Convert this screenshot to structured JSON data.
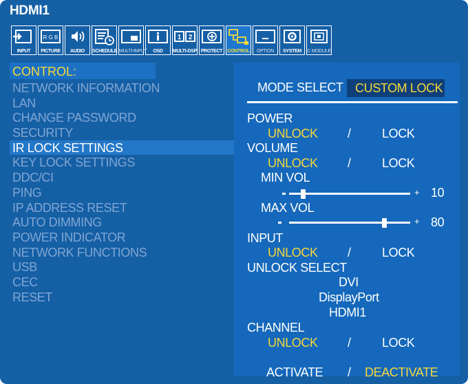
{
  "window": {
    "title": "HDMI1"
  },
  "toolbar": [
    {
      "label": "INPUT",
      "icon": "input-icon"
    },
    {
      "label": "PICTURE",
      "icon": "picture-rgb-icon"
    },
    {
      "label": "AUDIO",
      "icon": "speaker-icon"
    },
    {
      "label": "SCHEDULE",
      "icon": "schedule-icon"
    },
    {
      "label": "MULTI-INPUT",
      "icon": "multi-input-icon"
    },
    {
      "label": "OSD",
      "icon": "info-icon"
    },
    {
      "label": "MULTI-DSP",
      "icon": "multi-display-icon"
    },
    {
      "label": "PROTECT",
      "icon": "protect-plus-icon"
    },
    {
      "label": "CONTROL",
      "icon": "control-icon"
    },
    {
      "label": "OPTION",
      "icon": "option-icon"
    },
    {
      "label": "SYSTEM",
      "icon": "system-icon"
    },
    {
      "label": "C MODULE",
      "icon": "cmodule-icon"
    }
  ],
  "menu": {
    "header": "CONTROL:",
    "items": [
      "NETWORK INFORMATION",
      "LAN",
      "CHANGE PASSWORD",
      "SECURITY",
      "IR LOCK SETTINGS",
      "KEY LOCK SETTINGS",
      "DDC/CI",
      "PING",
      "IP ADDRESS RESET",
      "AUTO DIMMING",
      "POWER INDICATOR",
      "NETWORK FUNCTIONS",
      "USB",
      "CEC",
      "RESET"
    ],
    "active_index": 4
  },
  "detail": {
    "mode_select_label": "MODE SELECT",
    "mode_select_value": "CUSTOM LOCK",
    "power": {
      "label": "POWER",
      "unlock": "UNLOCK",
      "sep": "/",
      "lock": "LOCK"
    },
    "volume": {
      "label": "VOLUME",
      "unlock": "UNLOCK",
      "sep": "/",
      "lock": "LOCK"
    },
    "min_vol": {
      "label": "MIN VOL",
      "value": "10",
      "minus": "-",
      "plus": "+"
    },
    "max_vol": {
      "label": "MAX VOL",
      "value": "80",
      "minus": "-",
      "plus": "+"
    },
    "input": {
      "label": "INPUT",
      "unlock": "UNLOCK",
      "sep": "/",
      "lock": "LOCK"
    },
    "unlock_select": {
      "label": "UNLOCK SELECT",
      "options": [
        "DVI",
        "DisplayPort",
        "HDMI1"
      ]
    },
    "channel": {
      "label": "CHANNEL",
      "unlock": "UNLOCK",
      "sep": "/",
      "lock": "LOCK"
    },
    "footer": {
      "activate": "ACTIVATE",
      "sep": "/",
      "deactivate": "DEACTIVATE"
    }
  },
  "colors": {
    "background": "#155fa5",
    "right_panel": "#1568bb",
    "highlight": "#f6d83a",
    "selected_row": "#2377c8",
    "dim_text": "#7fa6d3"
  }
}
